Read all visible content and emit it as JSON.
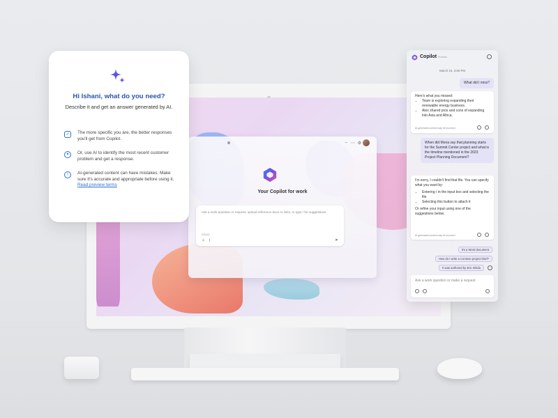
{
  "intro_card": {
    "title": "Hi Ishani, what do you need?",
    "subtitle": "Describe it and get an answer generated by AI.",
    "tips": [
      {
        "icon": "shield-check-icon",
        "text": "The more specific you are, the better responses you'll get from Copilot."
      },
      {
        "icon": "chat-sparkle-icon",
        "text": "Or, use AI to identify the most recent customer problem and get a response."
      },
      {
        "icon": "info-icon",
        "text": "AI-generated content can have mistakes. Make sure it's accurate and appropriate before using it.",
        "link": "Read preview terms"
      }
    ]
  },
  "app_window": {
    "title": "Your Copilot for work",
    "input_placeholder": "Ask a work question or request, upload reference docs or links, or type / for suggestions",
    "counter": "0/2000"
  },
  "copilot_panel": {
    "title": "Copilot",
    "badge": "Preview",
    "timestamp": "March 16, 3:56 PM",
    "messages": [
      {
        "role": "user",
        "text": "What did I miss?"
      },
      {
        "role": "bot",
        "intro": "Here's what you missed:",
        "bullets": [
          "Team is exploring expanding their renewable energy business.",
          "Alex shared pros and cons of expanding into Asia and Africa."
        ],
        "note": "AI-generated content may be incorrect"
      },
      {
        "role": "user",
        "text": "When did Mona say that planning starts for the Summit Center project and what is the timeline mentioned in the 2023 Project Planning Document?"
      },
      {
        "role": "bot",
        "intro": "I'm sorry, I couldn't find that file. You can specify what you want by:",
        "bullets": [
          "Entering / in the input box and selecting the file",
          "Selecting this button      to attach it"
        ],
        "outro": "Or refine your input using one of the suggestions below.",
        "note": "AI-generated content may be incorrect"
      }
    ],
    "suggestions": [
      "It's a Word document",
      "How do I write a Contoso project brief?",
      "It was authored by Eric Ishida"
    ],
    "input_placeholder": "Ask a work question or make a request"
  },
  "colors": {
    "accent": "#2b6fd6",
    "title_blue": "#2b56a8",
    "user_bubble": "#e3e2f7"
  }
}
